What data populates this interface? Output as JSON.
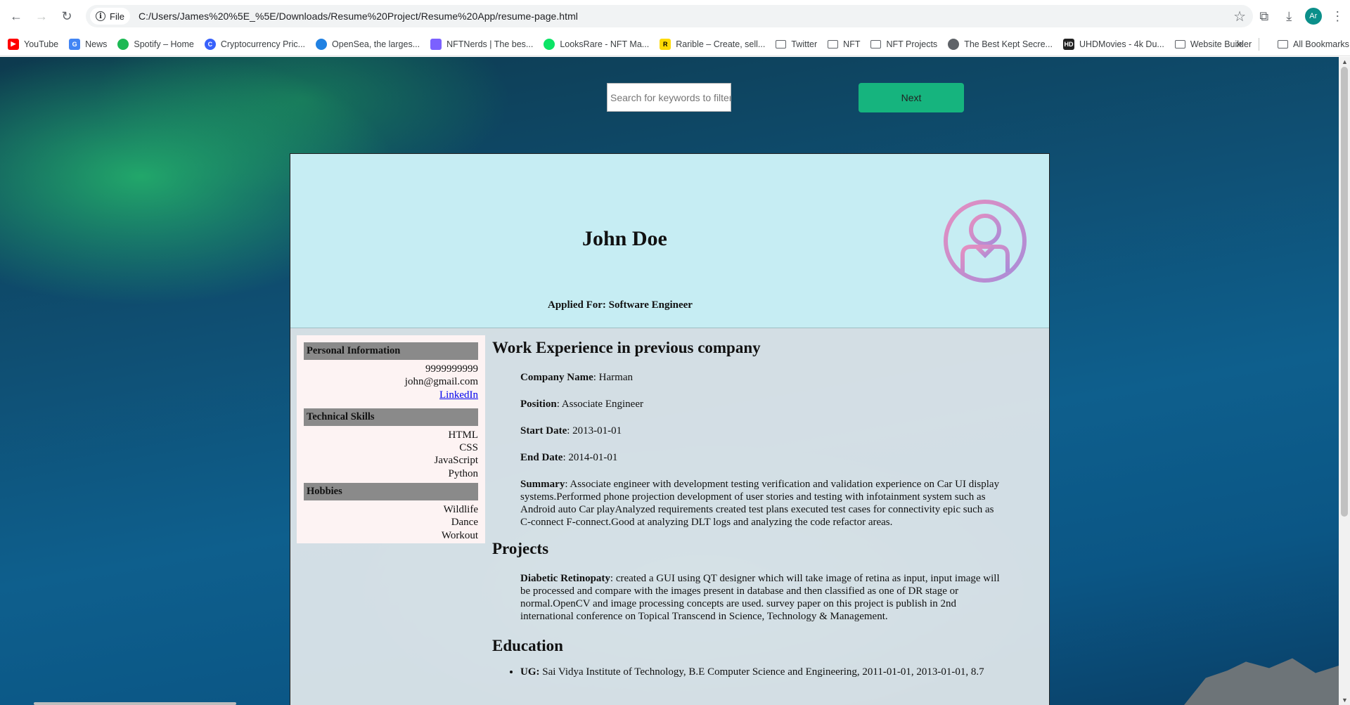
{
  "browser": {
    "site_info_label": "File",
    "url": "C:/Users/James%20%5E_%5E/Downloads/Resume%20Project/Resume%20App/resume-page.html",
    "profile_initials": "Ar"
  },
  "bookmarks": [
    {
      "label": "YouTube",
      "icon": "youtube-icon",
      "color": "#ff0000"
    },
    {
      "label": "News",
      "icon": "news-icon",
      "color": "#4285f4"
    },
    {
      "label": "Spotify – Home",
      "icon": "spotify-icon",
      "color": "#1db954"
    },
    {
      "label": "Cryptocurrency Pric...",
      "icon": "coinmarketcap-icon",
      "color": "#3861fb"
    },
    {
      "label": "OpenSea, the larges...",
      "icon": "opensea-icon",
      "color": "#2081e2"
    },
    {
      "label": "NFTNerds | The bes...",
      "icon": "nftnerds-icon",
      "color": "#7b61ff"
    },
    {
      "label": "LooksRare - NFT Ma...",
      "icon": "looksrare-icon",
      "color": "#0ce466"
    },
    {
      "label": "Rarible – Create, sell...",
      "icon": "rarible-icon",
      "color": "#feda03"
    },
    {
      "label": "Twitter",
      "icon": "folder-icon"
    },
    {
      "label": "NFT",
      "icon": "folder-icon"
    },
    {
      "label": "NFT Projects",
      "icon": "folder-icon"
    },
    {
      "label": "The Best Kept Secre...",
      "icon": "globe-icon",
      "color": "#5f6368"
    },
    {
      "label": "UHDMovies - 4k Du...",
      "icon": "uhdmovies-icon",
      "color": "#222222"
    },
    {
      "label": "Website Builder",
      "icon": "folder-icon"
    }
  ],
  "all_bookmarks_label": "All Bookmarks",
  "page": {
    "search_placeholder": "Search for keywords to filter",
    "next_label": "Next"
  },
  "resume": {
    "name": "John Doe",
    "applied_for_label": "Applied For:",
    "applied_for_value": "Software Engineer",
    "sidebar": {
      "personal_heading": "Personal Information",
      "phone": "9999999999",
      "email": "john@gmail.com",
      "linkedin": "LinkedIn",
      "skills_heading": "Technical Skills",
      "skills": [
        "HTML",
        "CSS",
        "JavaScript",
        "Python"
      ],
      "hobbies_heading": "Hobbies",
      "hobbies": [
        "Wildlife",
        "Dance",
        "Workout"
      ]
    },
    "work": {
      "heading": "Work Experience in previous company",
      "company_label": "Company Name",
      "company": ": Harman",
      "position_label": "Position",
      "position": ": Associate Engineer",
      "start_label": "Start Date",
      "start": ": 2013-01-01",
      "end_label": "End Date",
      "end": ": 2014-01-01",
      "summary_label": "Summary",
      "summary": ": Associate engineer with development testing verification and validation experience on Car UI display systems.Performed phone projection development of user stories and testing with infotainment system such as Android auto Car playAnalyzed requirements created test plans executed test cases for connectivity epic such as C-connect F-connect.Good at analyzing DLT logs and analyzing the code refactor areas."
    },
    "projects": {
      "heading": "Projects",
      "title": "Diabetic Retinopaty",
      "description": ": created a GUI using QT designer which will take image of retina as input, input image will be processed and compare with the images present in database and then classified as one of DR stage or normal.OpenCV and image processing concepts are used. survey paper on this project is publish in 2nd international conference on Topical Transcend in Science, Technology & Management."
    },
    "education": {
      "heading": "Education",
      "ug_label": "UG:",
      "ug": " Sai Vidya Institute of Technology, B.E Computer Science and Engineering, 2011-01-01, 2013-01-01, 8.7"
    }
  }
}
